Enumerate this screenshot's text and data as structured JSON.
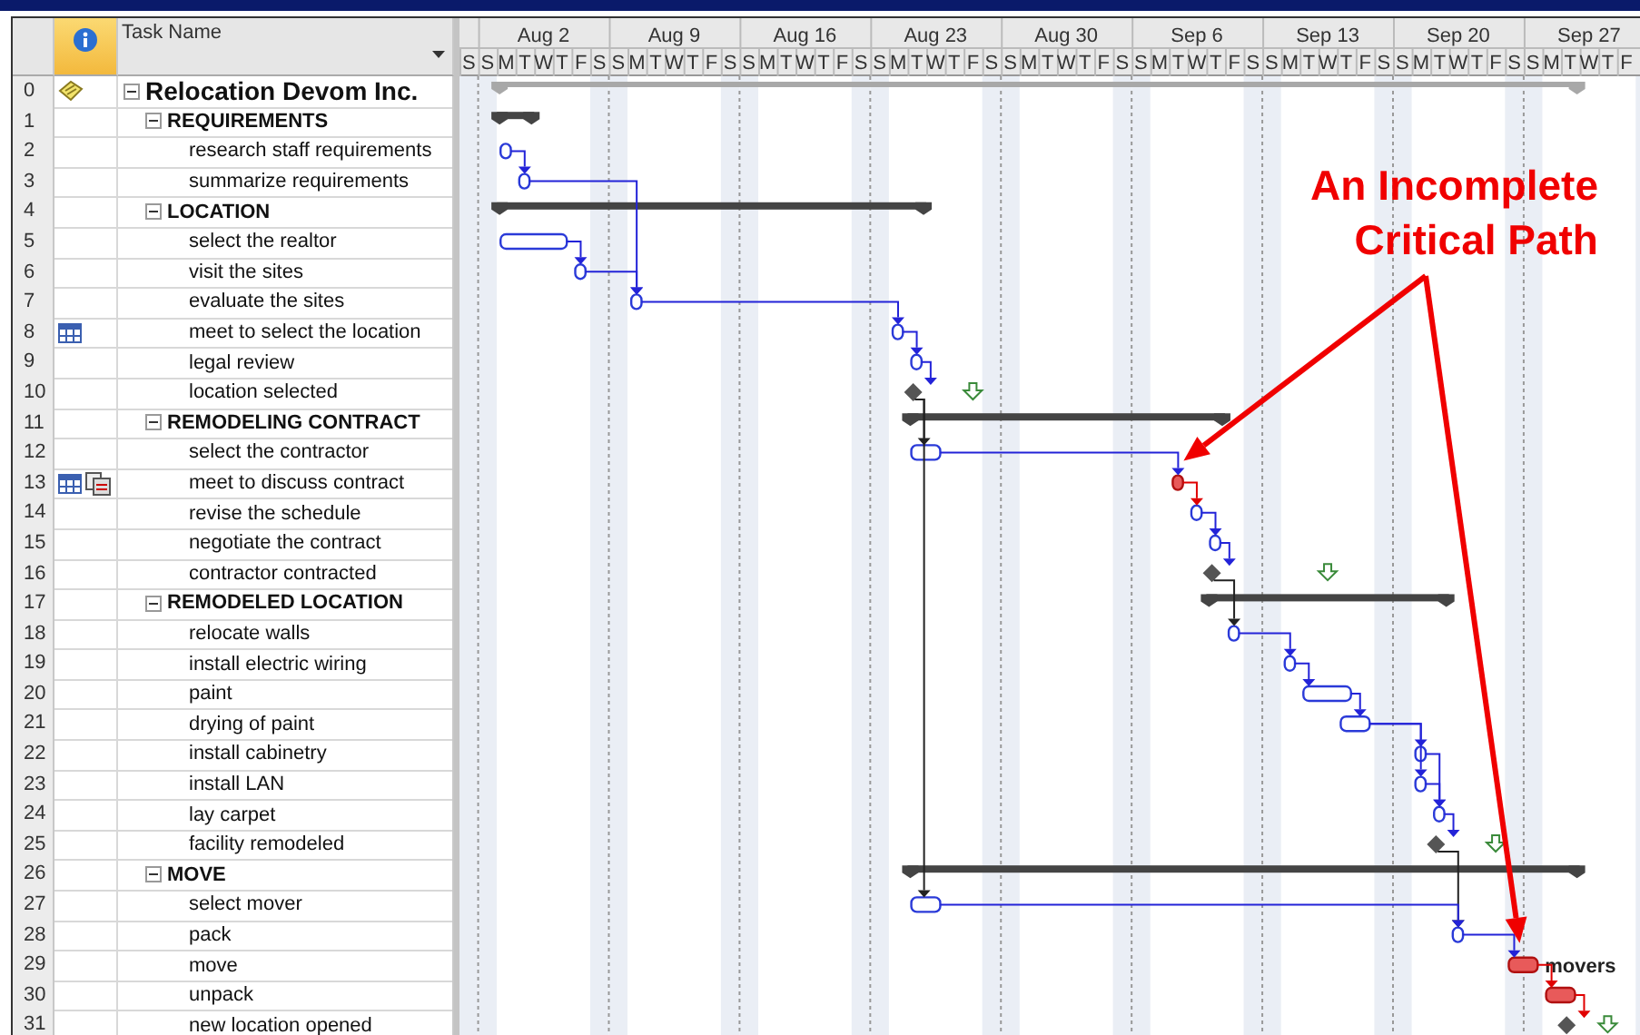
{
  "table": {
    "header": {
      "name_column": "Task Name"
    }
  },
  "timescale": {
    "lead_day": "S",
    "weeks": [
      {
        "label": "Aug 2",
        "days": [
          "S",
          "M",
          "T",
          "W",
          "T",
          "F",
          "S"
        ]
      },
      {
        "label": "Aug 9",
        "days": [
          "S",
          "M",
          "T",
          "W",
          "T",
          "F",
          "S"
        ]
      },
      {
        "label": "Aug 16",
        "days": [
          "S",
          "M",
          "T",
          "W",
          "T",
          "F",
          "S"
        ]
      },
      {
        "label": "Aug 23",
        "days": [
          "S",
          "M",
          "T",
          "W",
          "T",
          "F",
          "S"
        ]
      },
      {
        "label": "Aug 30",
        "days": [
          "S",
          "M",
          "T",
          "W",
          "T",
          "F",
          "S"
        ]
      },
      {
        "label": "Sep 6",
        "days": [
          "S",
          "M",
          "T",
          "W",
          "T",
          "F",
          "S"
        ]
      },
      {
        "label": "Sep 13",
        "days": [
          "S",
          "M",
          "T",
          "W",
          "T",
          "F",
          "S"
        ]
      },
      {
        "label": "Sep 20",
        "days": [
          "S",
          "M",
          "T",
          "W",
          "T",
          "F",
          "S"
        ]
      },
      {
        "label": "Sep 27",
        "days": [
          "S",
          "M",
          "T",
          "W",
          "T",
          "F"
        ]
      }
    ]
  },
  "tasks": [
    {
      "id": "0",
      "name": "Relocation Devom Inc.",
      "kind": "project",
      "expanded": true,
      "indicators": [
        {
          "kind": "note"
        }
      ],
      "children": [
        {
          "id": "1",
          "name": "REQUIREMENTS",
          "kind": "summary",
          "expanded": true,
          "children": [
            {
              "id": "2",
              "name": "research staff requirements",
              "kind": "task",
              "critical": false
            },
            {
              "id": "3",
              "name": "summarize requirements",
              "kind": "task",
              "critical": false
            }
          ]
        },
        {
          "id": "4",
          "name": "LOCATION",
          "kind": "summary",
          "expanded": true,
          "children": [
            {
              "id": "5",
              "name": "select the realtor",
              "kind": "task",
              "critical": false
            },
            {
              "id": "6",
              "name": "visit the sites",
              "kind": "task",
              "critical": false
            },
            {
              "id": "7",
              "name": "evaluate the sites",
              "kind": "task",
              "critical": false
            },
            {
              "id": "8",
              "name": "meet to select the location",
              "kind": "task",
              "critical": false,
              "indicators": [
                {
                  "kind": "calendar"
                }
              ]
            },
            {
              "id": "9",
              "name": "legal review",
              "kind": "task",
              "critical": false
            },
            {
              "id": "10",
              "name": "location selected",
              "kind": "milestone",
              "deadline": true
            }
          ]
        },
        {
          "id": "11",
          "name": "REMODELING CONTRACT",
          "kind": "summary",
          "expanded": true,
          "children": [
            {
              "id": "12",
              "name": "select the contractor",
              "kind": "task",
              "critical": false
            },
            {
              "id": "13",
              "name": "meet to discuss contract",
              "kind": "task",
              "critical": true,
              "indicators": [
                {
                  "kind": "calendar"
                },
                {
                  "kind": "linked"
                }
              ]
            },
            {
              "id": "14",
              "name": "revise the schedule",
              "kind": "task",
              "critical": false
            },
            {
              "id": "15",
              "name": "negotiate the contract",
              "kind": "task",
              "critical": false
            },
            {
              "id": "16",
              "name": "contractor contracted",
              "kind": "milestone",
              "deadline": true
            }
          ]
        },
        {
          "id": "17",
          "name": "REMODELED LOCATION",
          "kind": "summary",
          "expanded": true,
          "children": [
            {
              "id": "18",
              "name": "relocate walls",
              "kind": "task",
              "critical": false
            },
            {
              "id": "19",
              "name": "install electric wiring",
              "kind": "task",
              "critical": false
            },
            {
              "id": "20",
              "name": "paint",
              "kind": "task",
              "critical": false
            },
            {
              "id": "21",
              "name": "drying of paint",
              "kind": "task",
              "critical": false
            },
            {
              "id": "22",
              "name": "install cabinetry",
              "kind": "task",
              "critical": false
            },
            {
              "id": "23",
              "name": "install LAN",
              "kind": "task",
              "critical": false
            },
            {
              "id": "24",
              "name": "lay carpet",
              "kind": "task",
              "critical": false
            },
            {
              "id": "25",
              "name": "facility remodeled",
              "kind": "milestone",
              "deadline": true
            }
          ]
        },
        {
          "id": "26",
          "name": "MOVE",
          "kind": "summary",
          "expanded": true,
          "children": [
            {
              "id": "27",
              "name": "select mover",
              "kind": "task",
              "critical": false
            },
            {
              "id": "28",
              "name": "pack",
              "kind": "task",
              "critical": false
            },
            {
              "id": "29",
              "name": "move",
              "kind": "task",
              "critical": true,
              "resource": "movers"
            },
            {
              "id": "30",
              "name": "unpack",
              "kind": "task",
              "critical": true
            },
            {
              "id": "31",
              "name": "new location opened",
              "kind": "milestone",
              "deadline": true
            }
          ]
        }
      ]
    }
  ],
  "links": [
    {
      "critical": false
    },
    {
      "critical": false
    },
    {
      "critical": false
    },
    {
      "critical": false
    },
    {
      "critical": false
    },
    {
      "critical": false
    },
    {
      "critical": false
    },
    {
      "critical": false
    },
    {
      "critical": false
    },
    {
      "critical": false
    },
    {
      "critical": true
    },
    {
      "critical": false
    },
    {
      "critical": false
    },
    {
      "critical": false
    },
    {
      "critical": false
    },
    {
      "critical": false
    },
    {
      "critical": false
    },
    {
      "critical": false
    },
    {
      "critical": false
    },
    {
      "critical": false
    },
    {
      "critical": false
    },
    {
      "critical": false
    },
    {
      "critical": false
    },
    {
      "critical": false
    },
    {
      "critical": false
    },
    {
      "critical": true
    },
    {
      "critical": true
    }
  ],
  "callout": {
    "lines": [
      "An Incomplete",
      "Critical Path"
    ]
  }
}
